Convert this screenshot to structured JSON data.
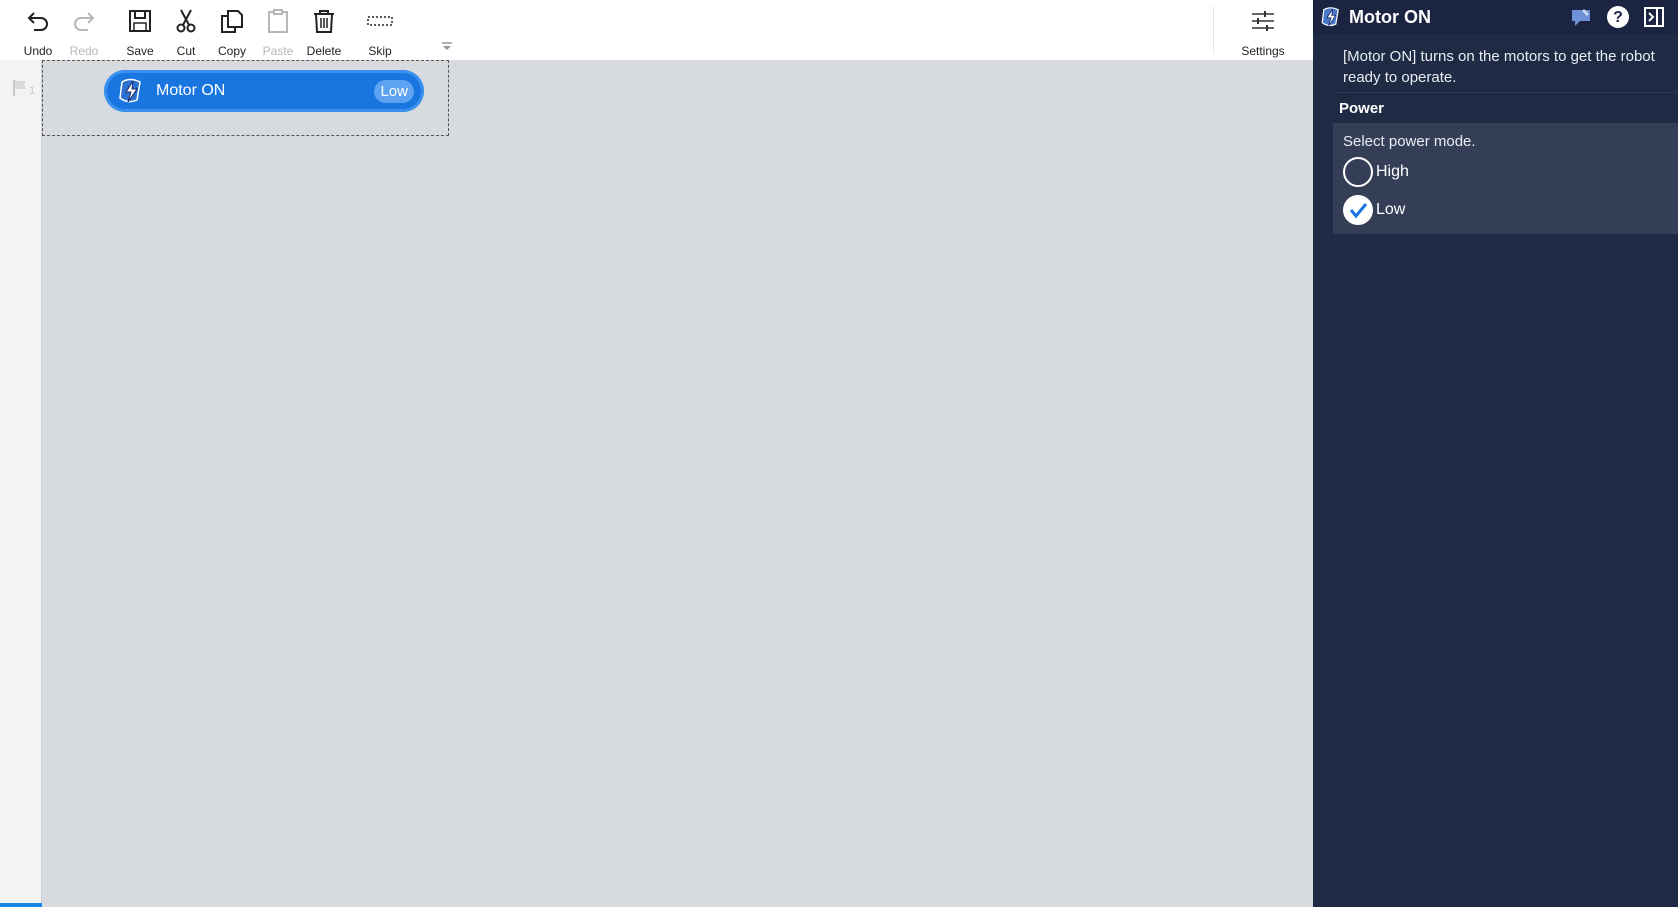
{
  "toolbar": {
    "undo": "Undo",
    "redo": "Redo",
    "save": "Save",
    "cut": "Cut",
    "copy": "Copy",
    "paste": "Paste",
    "delete": "Delete",
    "skip": "Skip",
    "settings": "Settings"
  },
  "gutter": {
    "line_number": "1"
  },
  "block": {
    "title": "Motor ON",
    "badge": "Low"
  },
  "panel": {
    "title": "Motor ON",
    "description": "[Motor ON] turns on the motors to get the robot ready to operate.",
    "section": "Power",
    "prompt": "Select power mode.",
    "options": [
      {
        "label": "High",
        "checked": false
      },
      {
        "label": "Low",
        "checked": true
      }
    ]
  },
  "colors": {
    "accent": "#1976e0",
    "panel_bg": "#1f2a44",
    "canvas_bg": "#d7dbdf"
  }
}
